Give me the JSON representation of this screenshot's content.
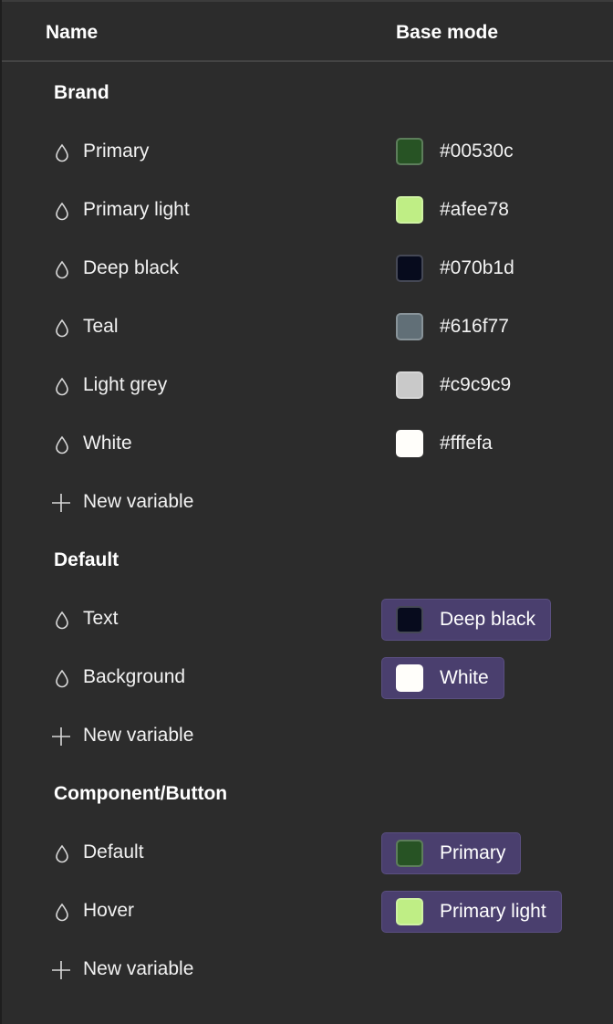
{
  "header": {
    "name_col": "Name",
    "mode_col": "Base mode"
  },
  "groups": [
    {
      "title": "Brand",
      "variables": [
        {
          "name": "Primary",
          "hex": "#00530c",
          "color": "#275324"
        },
        {
          "name": "Primary light",
          "hex": "#afee78",
          "color": "#bfee85"
        },
        {
          "name": "Deep black",
          "hex": "#070b1d",
          "color": "#070b1d"
        },
        {
          "name": "Teal",
          "hex": "#616f77",
          "color": "#616f77"
        },
        {
          "name": "Light grey",
          "hex": "#c9c9c9",
          "color": "#c9c9c9"
        },
        {
          "name": "White",
          "hex": "#fffefa",
          "color": "#fffefa"
        }
      ],
      "new_label": "New variable"
    },
    {
      "title": "Default",
      "variables": [
        {
          "name": "Text",
          "alias": "Deep black",
          "color": "#070b1d"
        },
        {
          "name": "Background",
          "alias": "White",
          "color": "#fffefa"
        }
      ],
      "new_label": "New variable"
    },
    {
      "title": "Component/Button",
      "variables": [
        {
          "name": "Default",
          "alias": "Primary",
          "color": "#275324"
        },
        {
          "name": "Hover",
          "alias": "Primary light",
          "color": "#bfee85"
        }
      ],
      "new_label": "New variable"
    }
  ],
  "icons": {
    "variable": "color-drop-icon",
    "add": "plus-icon"
  }
}
